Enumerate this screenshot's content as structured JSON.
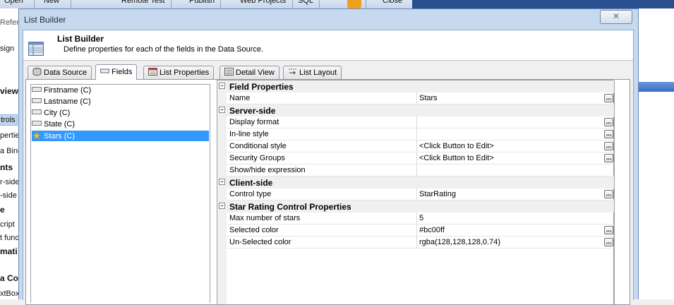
{
  "background": {
    "toolbar": [
      "Open",
      "New",
      "Remote Test",
      "Publish",
      "Web Projects",
      "SQL",
      "Close"
    ],
    "tabs": [
      "Refer"
    ],
    "left_items": [
      "sign",
      "view",
      "trols",
      "pertie",
      "a Bind",
      "nts",
      "r-side",
      "-side",
      "e",
      "cript",
      "t func",
      "mati",
      "a Co",
      "xtBox"
    ]
  },
  "dialog": {
    "title": "List Builder",
    "close_glyph": "✕",
    "header": {
      "title": "List Builder",
      "subtitle": "Define properties for each of the fields in the Data Source."
    },
    "tabs": [
      {
        "label": "Data Source",
        "icon": "database-icon"
      },
      {
        "label": "Fields",
        "icon": "fields-icon",
        "active": true
      },
      {
        "label": "List Properties",
        "icon": "list-properties-icon"
      },
      {
        "label": "Detail View",
        "icon": "detail-view-icon"
      },
      {
        "label": "List Layout",
        "icon": "list-layout-icon"
      }
    ]
  },
  "fields": [
    {
      "label": "Firstname (C)",
      "icon": "textbox-icon"
    },
    {
      "label": "Lastname (C)",
      "icon": "textbox-icon"
    },
    {
      "label": "City (C)",
      "icon": "textbox-icon"
    },
    {
      "label": "State (C)",
      "icon": "textbox-icon"
    },
    {
      "label": "Stars (C)",
      "icon": "star-icon",
      "selected": true
    }
  ],
  "property_grid": {
    "collapse_glyph": "−",
    "ellipsis": "...",
    "categories": {
      "field_properties": "Field Properties",
      "server_side": "Server-side",
      "client_side": "Client-side",
      "star_rating": "Star Rating Control Properties"
    },
    "rows": {
      "name": {
        "name": "Name",
        "value": "Stars"
      },
      "display_format": {
        "name": "Display format",
        "value": ""
      },
      "inline_style": {
        "name": "In-line style",
        "value": ""
      },
      "conditional_style": {
        "name": "Conditional style",
        "value": "<Click Button to Edit>"
      },
      "security_groups": {
        "name": "Security Groups",
        "value": "<Click Button to Edit>"
      },
      "show_hide": {
        "name": "Show/hide expression",
        "value": ""
      },
      "control_type": {
        "name": "Control type",
        "value": "StarRating"
      },
      "max_stars": {
        "name": "Max number of stars",
        "value": "5"
      },
      "selected_color": {
        "name": "Selected color",
        "value": "#bc00ff"
      },
      "unselected_color": {
        "name": "Un-Selected color",
        "value": "rgba(128,128,128,0.74)"
      }
    }
  },
  "colors": {
    "selection": "#3399ff",
    "dialog_frame": "#c7d9ef"
  }
}
